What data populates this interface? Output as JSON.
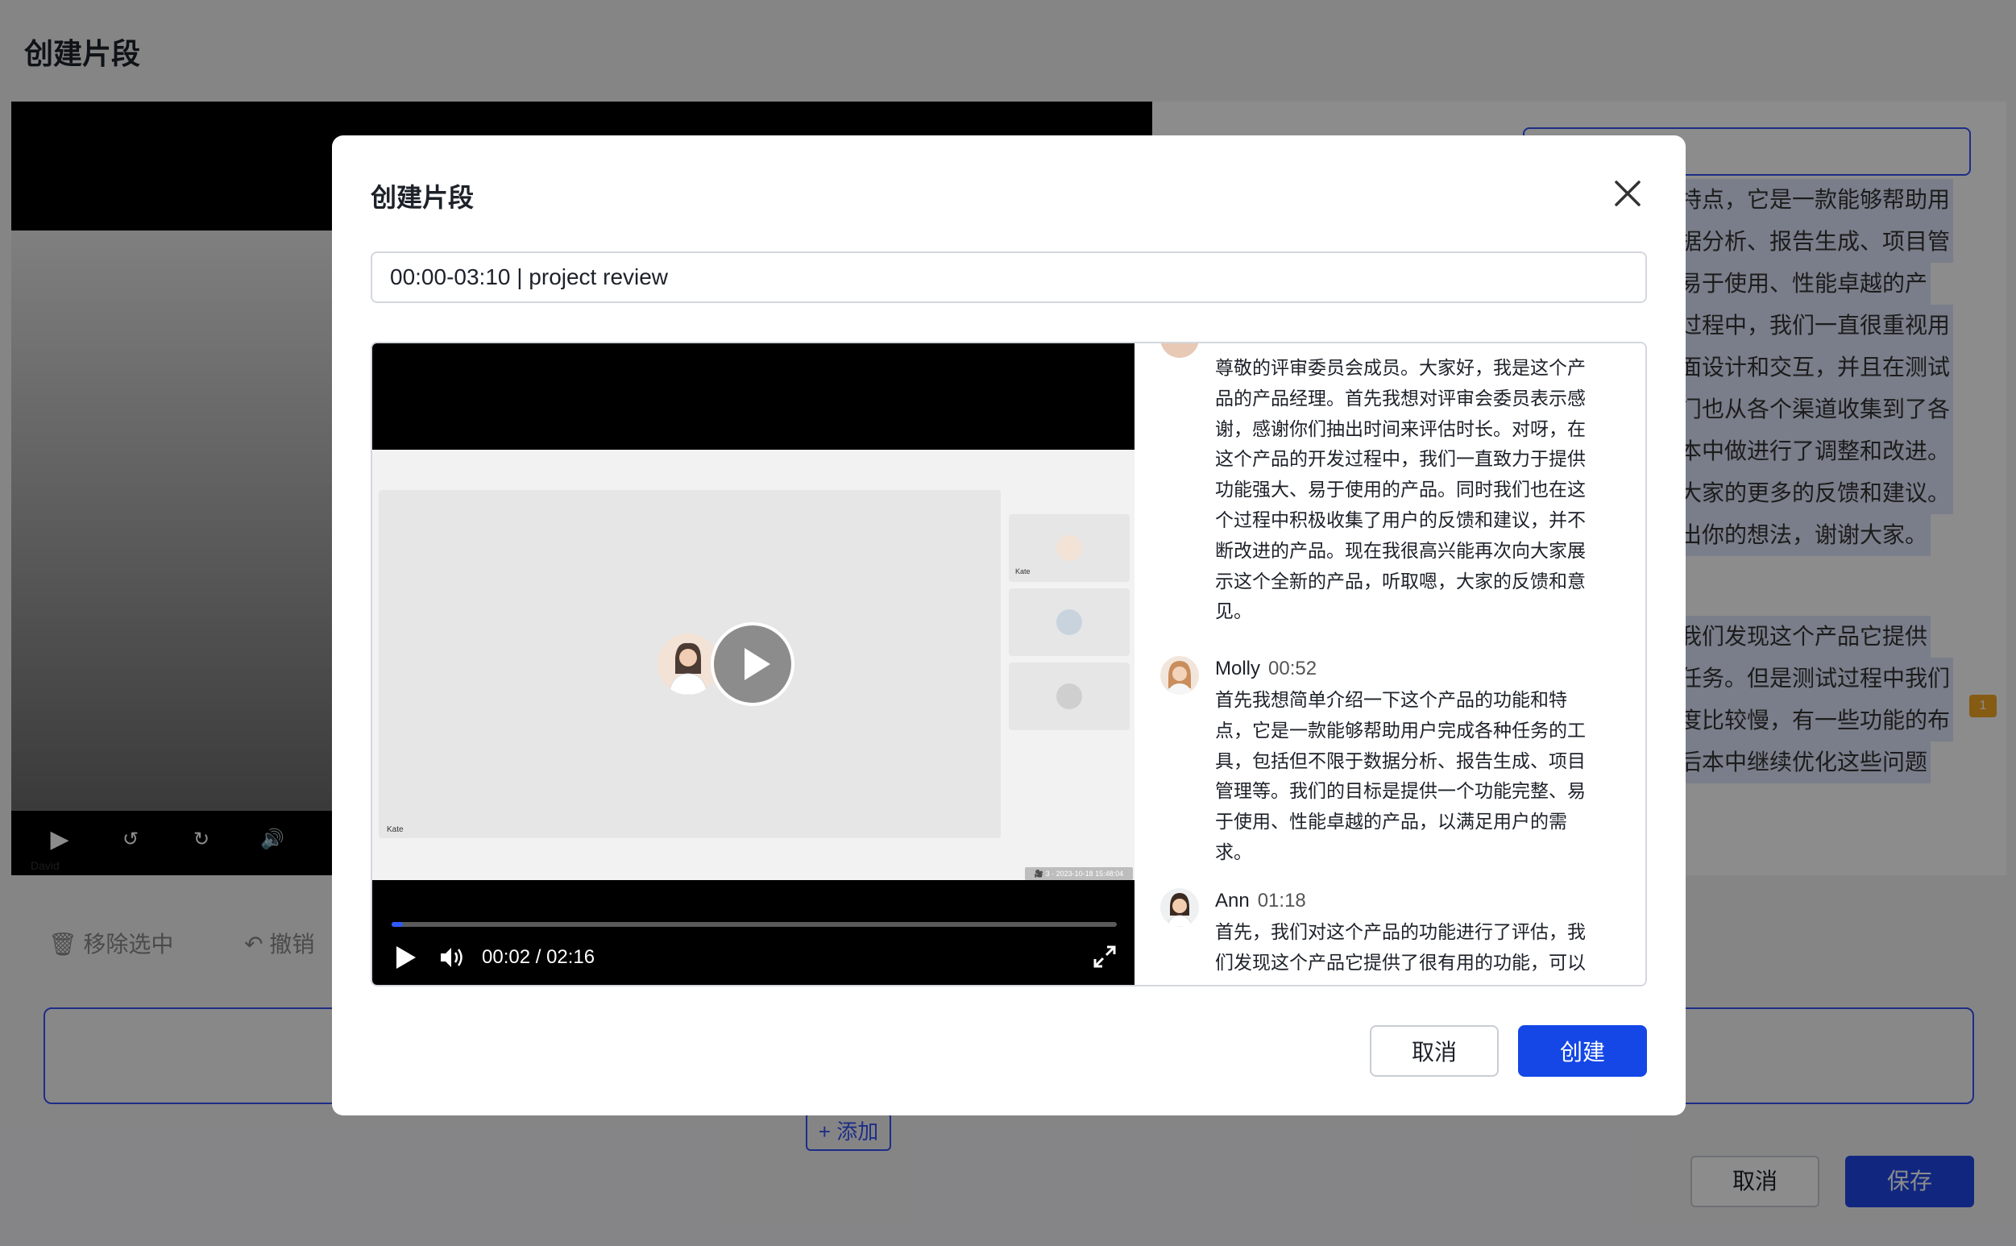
{
  "page": {
    "title": "创建片段",
    "bg_player": {
      "tile_name": "David"
    },
    "bg_transcript_lines": [
      "特点，它是一款能够帮助用",
      "据分析、报告生成、项目管",
      "易于使用、性能卓越的产",
      "过程中，我们一直很重视用",
      "面设计和交互，并且在测试",
      "门也从各个渠道收集到了各",
      "本中做进行了调整和改进。",
      "大家的更多的反馈和建议。",
      "出你的想法，谢谢大家。",
      "",
      "我们发现这个产品它提供",
      "任务。但是测试过程中我们",
      "度比较慢，有一些功能的布",
      "后本中继续优化这些问题"
    ],
    "comment_badge": "1",
    "toolbar": {
      "remove_selected": "移除选中",
      "undo": "撤销"
    },
    "add_label": "+ 添加",
    "cancel_label": "取消",
    "save_label": "保存"
  },
  "modal": {
    "title": "创建片段",
    "clip_name": "00:00-03:10 | project review",
    "player": {
      "main_tile_name": "Kate",
      "side_tiles": [
        {
          "name": "Kate"
        },
        {
          "name": ""
        },
        {
          "name": ""
        }
      ],
      "timestamp_tag": "🎥 3 · 2023-10-18 15:48:04",
      "time_display": "00:02 / 02:16",
      "progress": 0.015
    },
    "transcript": [
      {
        "speaker": "",
        "time": "",
        "text": "尊敬的评审委员会成员。大家好，我是这个产品的产品经理。首先我想对评审会委员表示感谢，感谢你们抽出时间来评估时长。对呀，在这个产品的开发过程中，我们一直致力于提供功能强大、易于使用的产品。同时我们也在这个过程中积极收集了用户的反馈和建议，并不断改进的产品。现在我很高兴能再次向大家展示这个全新的产品，听取嗯，大家的反馈和意见。",
        "lines": [
          "尊敬的评审委员会成员。大家好，我是这个产",
          "品的产品经理。首先我想对评审会委员表示感",
          "谢，感谢你们抽出时间来评估时长。对呀，在",
          "这个产品的开发过程中，我们一直致力于提供",
          "功能强大、易于使用的产品。同时我们也在这",
          "个过程中积极收集了用户的反馈和建议，并不",
          "断改进的产品。现在我很高兴能再次向大家展",
          "示这个全新的产品，听取嗯，大家的反馈和意",
          "见。"
        ]
      },
      {
        "speaker": "Molly",
        "time": "00:52",
        "lines": [
          "首先我想简单介绍一下这个产品的功能和特",
          "点，它是一款能够帮助用户完成各种任务的工",
          "具，包括但不限于数据分析、报告生成、项目",
          "管理等。我们的目标是提供一个功能完整、易",
          "于使用、性能卓越的产品，以满足用户的需",
          "求。"
        ]
      },
      {
        "speaker": "Ann",
        "time": "01:18",
        "lines": [
          "首先，我们对这个产品的功能进行了评估，我",
          "们发现这个产品它提供了很有用的功能，可以"
        ]
      }
    ],
    "cancel_label": "取消",
    "create_label": "创建"
  },
  "colors": {
    "primary": "#1447e6",
    "progress": "#2d5bff",
    "overlay": "rgba(0,0,0,0.45)"
  },
  "icons": [
    "close-icon",
    "play-icon",
    "volume-icon",
    "fullscreen-icon",
    "rewind-15-icon",
    "forward-15-icon",
    "trash-icon",
    "undo-icon"
  ]
}
